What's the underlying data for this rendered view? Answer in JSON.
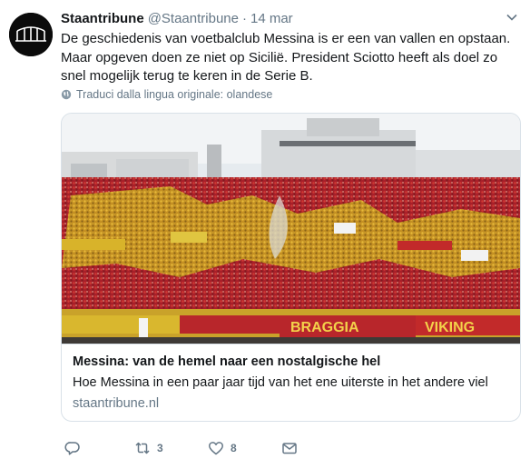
{
  "tweet": {
    "display_name": "Staantribune",
    "handle": "@Staantribune",
    "separator": "·",
    "date": "14 mar",
    "text": "De geschiedenis van voetbalclub Messina is er een van vallen en opstaan. Maar opgeven doen ze niet op Sicilië. President Sciotto heeft als doel zo snel mogelijk terug te keren in de Serie B.",
    "translate_label": "Traduci dalla lingua originale: olandese",
    "avatar_icon": "stadium-logo-icon",
    "menu_icon": "chevron-down-icon"
  },
  "card": {
    "image_alt": "stadium-crowd-photo",
    "banner_texts": [
      "BRAGGIA",
      "VIKING"
    ],
    "title": "Messina: van de hemel naar een nostalgische hel",
    "description": "Hoe Messina in een paar jaar tijd van het ene uiterste in het andere viel",
    "domain": "staantribune.nl"
  },
  "actions": {
    "reply_icon": "reply-icon",
    "retweet_icon": "retweet-icon",
    "retweet_count": "3",
    "like_icon": "heart-icon",
    "like_count": "8",
    "dm_icon": "envelope-icon"
  },
  "colors": {
    "text": "#14171a",
    "secondary": "#657786",
    "border": "#d9e1e8",
    "crowd_red": "#b8252b",
    "crowd_yellow": "#d8b32a"
  }
}
